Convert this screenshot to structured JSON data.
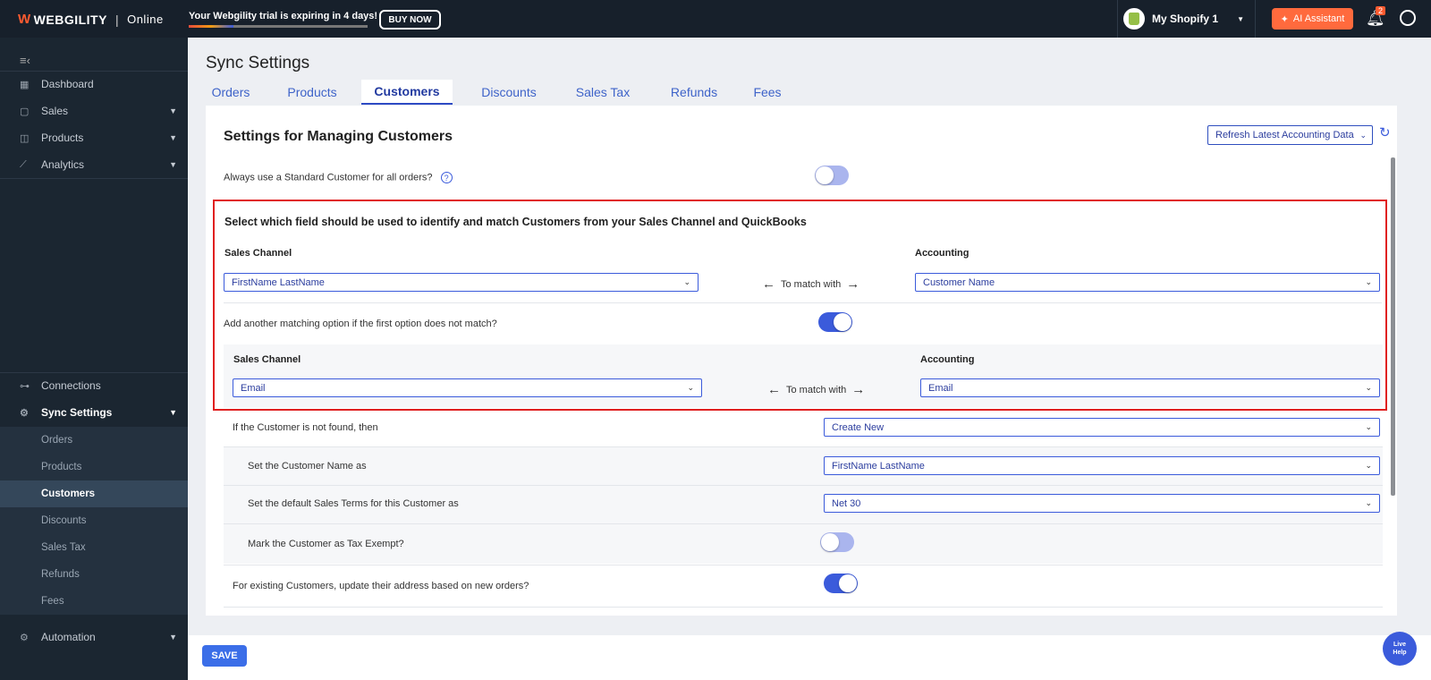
{
  "topbar": {
    "brand": "WEBGILITY",
    "brand_sep": "|",
    "edition": "Online",
    "trial_text": "Your Webgility trial is expiring in 4 days!",
    "trial_progress_fraction": 0.25,
    "buy_now": "BUY NOW",
    "store_name": "My Shopify 1",
    "ai_assistant": "AI Assistant",
    "notification_count": "2"
  },
  "sidebar": {
    "items": [
      {
        "label": "Dashboard",
        "icon": "dashboard-icon"
      },
      {
        "label": "Sales",
        "icon": "bag-icon"
      },
      {
        "label": "Products",
        "icon": "box-icon"
      },
      {
        "label": "Analytics",
        "icon": "chart-icon"
      },
      {
        "label": "Connections",
        "icon": "connections-icon"
      },
      {
        "label": "Sync Settings",
        "icon": "gear-icon"
      },
      {
        "label": "Automation",
        "icon": "automation-icon"
      }
    ],
    "sub_items": [
      "Orders",
      "Products",
      "Customers",
      "Discounts",
      "Sales Tax",
      "Refunds",
      "Fees"
    ],
    "active_sub_item": "Customers"
  },
  "page": {
    "title": "Sync Settings",
    "tabs": [
      "Orders",
      "Products",
      "Customers",
      "Discounts",
      "Sales Tax",
      "Refunds",
      "Fees"
    ],
    "active_tab": "Customers"
  },
  "settings": {
    "title": "Settings for Managing Customers",
    "refresh_label": "Refresh Latest Accounting Data",
    "standard_customer_label": "Always use a Standard Customer for all orders?",
    "standard_customer_on": false,
    "match_heading": "Select which field should be used to identify and match Customers from your Sales Channel and QuickBooks",
    "sales_channel_label": "Sales Channel",
    "accounting_label": "Accounting",
    "match_text": "To match with",
    "primary_sales_value": "FirstName LastName",
    "primary_accounting_value": "Customer Name",
    "another_option_label": "Add another matching option if the first option does not match?",
    "another_option_on": true,
    "secondary_sales_value": "Email",
    "secondary_accounting_value": "Email",
    "not_found_label": "If the Customer is not found, then",
    "not_found_value": "Create New",
    "customer_name_label": "Set the Customer Name as",
    "customer_name_value": "FirstName LastName",
    "sales_terms_label": "Set the default Sales Terms for this Customer as",
    "sales_terms_value": "Net 30",
    "tax_exempt_label": "Mark the Customer as Tax Exempt?",
    "tax_exempt_on": false,
    "update_address_label": "For existing Customers, update their address based on new orders?",
    "update_address_on": true
  },
  "footer": {
    "save": "SAVE",
    "live_help_line1": "Live",
    "live_help_line2": "Help"
  },
  "colors": {
    "accent": "#3b5bdb",
    "brand_orange": "#ff6a3d",
    "highlight_red": "#e02020",
    "sidebar_bg": "#1b2631"
  }
}
